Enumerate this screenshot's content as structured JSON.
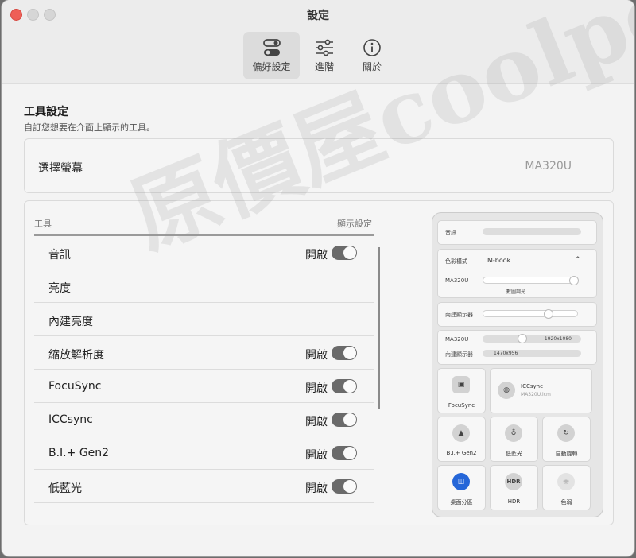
{
  "window": {
    "title": "設定"
  },
  "toolbar": {
    "tabs": [
      {
        "label": "偏好設定",
        "icon": "toggles-icon",
        "active": true
      },
      {
        "label": "進階",
        "icon": "sliders-icon",
        "active": false
      },
      {
        "label": "關於",
        "icon": "info-icon",
        "active": false
      }
    ]
  },
  "section": {
    "title": "工具設定",
    "subtitle": "自訂您想要在介面上顯示的工具。"
  },
  "monitor": {
    "label": "選擇螢幕",
    "value": "MA320U"
  },
  "tools": {
    "header_left": "工具",
    "header_right": "顯示設定",
    "rows": [
      {
        "label": "音訊",
        "state": "開啟",
        "toggle": true
      },
      {
        "label": "亮度",
        "state": "",
        "toggle": false
      },
      {
        "label": "內建亮度",
        "state": "",
        "toggle": false
      },
      {
        "label": "縮放解析度",
        "state": "開啟",
        "toggle": true
      },
      {
        "label": "FocuSync",
        "state": "開啟",
        "toggle": true
      },
      {
        "label": "ICCsync",
        "state": "開啟",
        "toggle": true
      },
      {
        "label": "B.I.+ Gen2",
        "state": "開啟",
        "toggle": true
      },
      {
        "label": "低藍光",
        "state": "開啟",
        "toggle": true
      }
    ]
  },
  "preview": {
    "audio_label": "音訊",
    "color_mode_label": "色彩模式",
    "color_mode_value": "M-book",
    "brightness_monitor": "MA320U",
    "brightness_sub": "數圖調光",
    "builtin_label": "內建顯示器",
    "res_monitor": "MA320U",
    "res_monitor_value": "1920x1080",
    "res_builtin": "內建顯示器",
    "res_builtin_value": "1470x956",
    "focusync": "FocuSync",
    "iccsync_title": "ICCsync",
    "iccsync_file": "MA320U.icm",
    "tiles": [
      {
        "label": "B.I.+ Gen2",
        "icon": "bi-icon"
      },
      {
        "label": "低藍光",
        "icon": "bulb-icon"
      },
      {
        "label": "自動旋轉",
        "icon": "rotate-icon"
      },
      {
        "label": "桌面分區",
        "icon": "split-icon"
      },
      {
        "label": "HDR",
        "icon": "hdr-icon",
        "icon_text": "HDR"
      },
      {
        "label": "色弱",
        "icon": "eye-icon"
      }
    ]
  },
  "watermark": "原價屋coolpc"
}
